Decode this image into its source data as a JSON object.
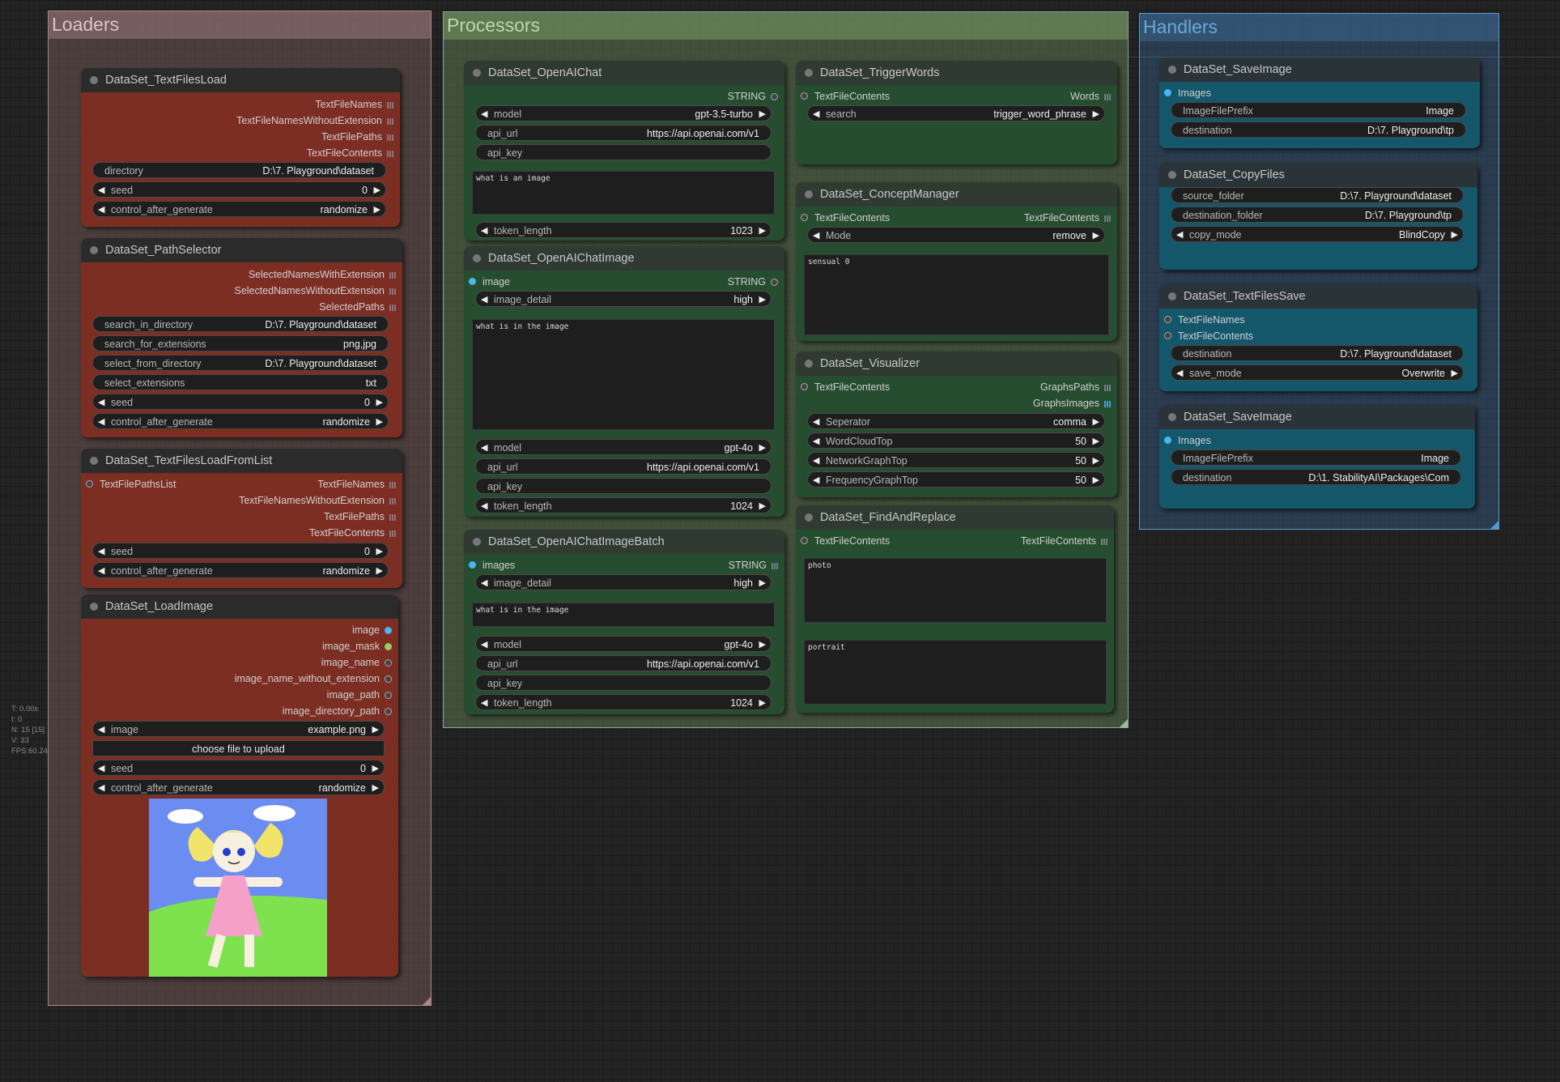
{
  "groups": {
    "loaders": "Loaders",
    "processors": "Processors",
    "handlers": "Handlers"
  },
  "stats": [
    "T: 0.00s",
    "I: 0",
    "N: 15 [15]",
    "V: 33",
    "FPS:60.24"
  ],
  "nodes": {
    "textfilesload": {
      "title": "DataSet_TextFilesLoad",
      "outputs": [
        "TextFileNames",
        "TextFileNamesWithoutExtension",
        "TextFilePaths",
        "TextFileContents"
      ],
      "directory": {
        "label": "directory",
        "value": "D:\\7. Playground\\dataset"
      },
      "seed": {
        "label": "seed",
        "value": "0"
      },
      "control": {
        "label": "control_after_generate",
        "value": "randomize"
      }
    },
    "pathselector": {
      "title": "DataSet_PathSelector",
      "outputs": [
        "SelectedNamesWithExtension",
        "SelectedNamesWithoutExtension",
        "SelectedPaths"
      ],
      "search_in_directory": {
        "label": "search_in_directory",
        "value": "D:\\7. Playground\\dataset"
      },
      "search_for_extensions": {
        "label": "search_for_extensions",
        "value": "png,jpg"
      },
      "select_from_directory": {
        "label": "select_from_directory",
        "value": "D:\\7. Playground\\dataset"
      },
      "select_extensions": {
        "label": "select_extensions",
        "value": "txt"
      },
      "seed": {
        "label": "seed",
        "value": "0"
      },
      "control": {
        "label": "control_after_generate",
        "value": "randomize"
      }
    },
    "loadfromlist": {
      "title": "DataSet_TextFilesLoadFromList",
      "input": "TextFilePathsList",
      "outputs": [
        "TextFileNames",
        "TextFileNamesWithoutExtension",
        "TextFilePaths",
        "TextFileContents"
      ],
      "seed": {
        "label": "seed",
        "value": "0"
      },
      "control": {
        "label": "control_after_generate",
        "value": "randomize"
      }
    },
    "loadimage": {
      "title": "DataSet_LoadImage",
      "outputs": [
        "image",
        "image_mask",
        "image_name",
        "image_name_without_extension",
        "image_path",
        "image_directory_path"
      ],
      "image": {
        "label": "image",
        "value": "example.png"
      },
      "upload": "choose file to upload",
      "seed": {
        "label": "seed",
        "value": "0"
      },
      "control": {
        "label": "control_after_generate",
        "value": "randomize"
      }
    },
    "openaichat": {
      "title": "DataSet_OpenAIChat",
      "output": "STRING",
      "model": {
        "label": "model",
        "value": "gpt-3.5-turbo"
      },
      "api_url": {
        "label": "api_url",
        "value": "https://api.openai.com/v1"
      },
      "api_key": {
        "label": "api_key",
        "value": ""
      },
      "prompt": "what is an image",
      "token_length": {
        "label": "token_length",
        "value": "1023"
      }
    },
    "openaichatimage": {
      "title": "DataSet_OpenAIChatImage",
      "input": "image",
      "output": "STRING",
      "image_detail": {
        "label": "image_detail",
        "value": "high"
      },
      "prompt": "what is in the image",
      "model": {
        "label": "model",
        "value": "gpt-4o"
      },
      "api_url": {
        "label": "api_url",
        "value": "https://api.openai.com/v1"
      },
      "api_key": {
        "label": "api_key",
        "value": ""
      },
      "token_length": {
        "label": "token_length",
        "value": "1024"
      }
    },
    "openaichatimagebatch": {
      "title": "DataSet_OpenAIChatImageBatch",
      "input": "images",
      "output": "STRING",
      "image_detail": {
        "label": "image_detail",
        "value": "high"
      },
      "prompt": "what is in the image",
      "model": {
        "label": "model",
        "value": "gpt-4o"
      },
      "api_url": {
        "label": "api_url",
        "value": "https://api.openai.com/v1"
      },
      "api_key": {
        "label": "api_key",
        "value": ""
      },
      "token_length": {
        "label": "token_length",
        "value": "1024"
      }
    },
    "triggerwords": {
      "title": "DataSet_TriggerWords",
      "input": "TextFileContents",
      "output": "Words",
      "search": {
        "label": "search",
        "value": "trigger_word_phrase"
      }
    },
    "conceptmanager": {
      "title": "DataSet_ConceptManager",
      "input": "TextFileContents",
      "output": "TextFileContents",
      "mode": {
        "label": "Mode",
        "value": "remove"
      },
      "text": "sensual 0"
    },
    "visualizer": {
      "title": "DataSet_Visualizer",
      "input": "TextFileContents",
      "outputs": [
        "GraphsPaths",
        "GraphsImages"
      ],
      "seperator": {
        "label": "Seperator",
        "value": "comma"
      },
      "wordcloud": {
        "label": "WordCloudTop",
        "value": "50"
      },
      "network": {
        "label": "NetworkGraphTop",
        "value": "50"
      },
      "frequency": {
        "label": "FrequencyGraphTop",
        "value": "50"
      }
    },
    "findandreplace": {
      "title": "DataSet_FindAndReplace",
      "input": "TextFileContents",
      "output": "TextFileContents",
      "find": "photo",
      "replace": "portrait"
    },
    "saveimage1": {
      "title": "DataSet_SaveImage",
      "input": "Images",
      "prefix": {
        "label": "ImageFilePrefix",
        "value": "Image"
      },
      "destination": {
        "label": "destination",
        "value": "D:\\7. Playground\\tp"
      }
    },
    "copyfiles": {
      "title": "DataSet_CopyFiles",
      "source": {
        "label": "source_folder",
        "value": "D:\\7. Playground\\dataset"
      },
      "destination": {
        "label": "destination_folder",
        "value": "D:\\7. Playground\\tp"
      },
      "mode": {
        "label": "copy_mode",
        "value": "BlindCopy"
      }
    },
    "textfilessave": {
      "title": "DataSet_TextFilesSave",
      "inputs": [
        "TextFileNames",
        "TextFileContents"
      ],
      "destination": {
        "label": "destination",
        "value": "D:\\7. Playground\\dataset"
      },
      "save_mode": {
        "label": "save_mode",
        "value": "Overwrite"
      }
    },
    "saveimage2": {
      "title": "DataSet_SaveImage",
      "input": "Images",
      "prefix": {
        "label": "ImageFilePrefix",
        "value": "Image"
      },
      "destination": {
        "label": "destination",
        "value": "D:\\1. StabilityAI\\Packages\\Com"
      }
    }
  },
  "colors": {
    "loader_node": "#7d2e23",
    "processor_node": "#264d2f",
    "handler_node": "#14566a",
    "image_socket": "#4ab5f0"
  }
}
